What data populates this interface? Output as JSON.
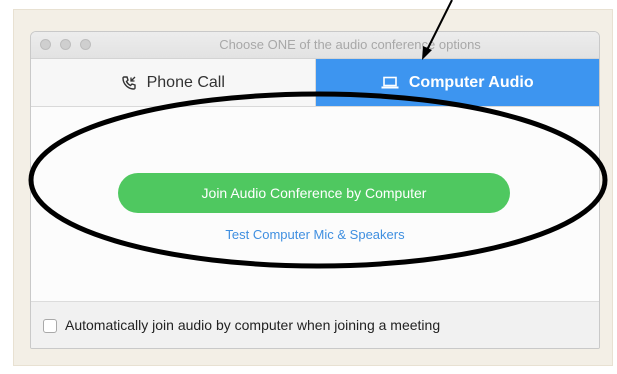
{
  "window": {
    "title": "Choose ONE of the audio conference options"
  },
  "tabs": [
    {
      "label": "Phone Call",
      "icon": "phone-icon",
      "selected": false
    },
    {
      "label": "Computer Audio",
      "icon": "laptop-icon",
      "selected": true
    }
  ],
  "main": {
    "join_button_label": "Join Audio Conference by Computer",
    "test_link_label": "Test Computer Mic & Speakers"
  },
  "footer": {
    "auto_join_label": "Automatically join audio by computer when joining a meeting",
    "auto_join_checked": false
  },
  "colors": {
    "selected_tab": "#3d95f0",
    "join_button": "#4fc860",
    "link": "#3f8fe0",
    "annotation": "#000000"
  },
  "annotations": {
    "arrow": "arrow-annotation",
    "ellipse": "ellipse-annotation"
  }
}
